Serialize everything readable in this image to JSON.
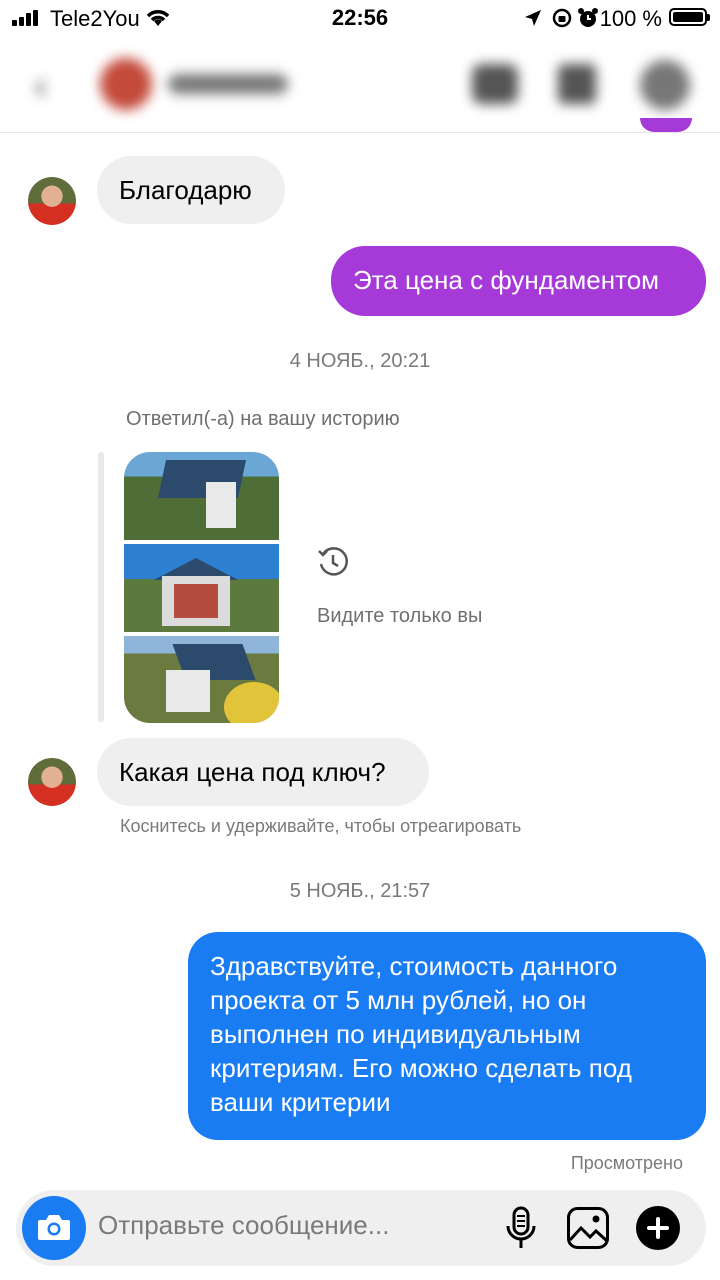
{
  "status_bar": {
    "carrier": "Tele2You",
    "time": "22:56",
    "battery": "100 %"
  },
  "header": {
    "name": "",
    "blurred": true
  },
  "messages": [
    {
      "type": "incoming",
      "text": "Благодарю"
    },
    {
      "type": "outgoing",
      "text": "Эта цена с фундаментом",
      "color": "#a63ad8"
    }
  ],
  "timestamp_1": "4 НОЯБ., 20:21",
  "story_reply": {
    "label": "Ответил(-а) на вашу историю",
    "visibility": "Видите только вы"
  },
  "message_question": {
    "text": "Какая цена под ключ?",
    "hint": "Коснитесь и удерживайте, чтобы отреагировать"
  },
  "timestamp_2": "5 НОЯБ., 21:57",
  "reply": {
    "text": "Здравствуйте, стоимость данного проекта от 5 млн рублей, но он выполнен по индивидуальным критериям. Его можно сделать под ваши критерии",
    "color": "#1a7cf3",
    "status": "Просмотрено"
  },
  "composer": {
    "placeholder": "Отправьте сообщение..."
  },
  "icons": {
    "camera": "camera-icon",
    "mic": "microphone-icon",
    "gallery": "gallery-icon",
    "plus": "plus-icon",
    "history": "history-icon"
  }
}
